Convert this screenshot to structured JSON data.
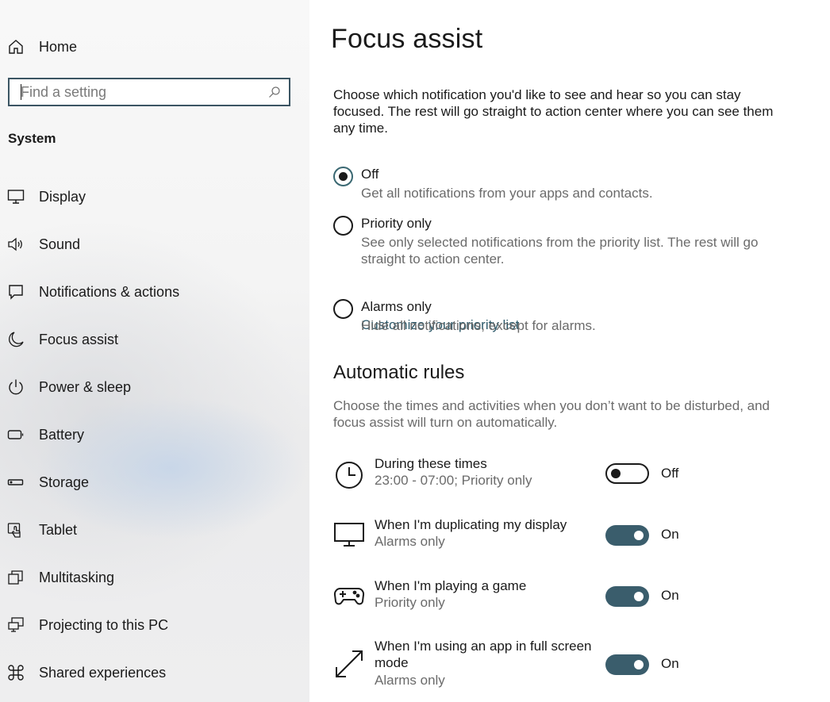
{
  "sidebar": {
    "home_label": "Home",
    "search": {
      "placeholder": "Find a setting",
      "value": ""
    },
    "section_title": "System",
    "items": [
      {
        "label": "Display",
        "icon": "display-icon"
      },
      {
        "label": "Sound",
        "icon": "speaker-icon"
      },
      {
        "label": "Notifications & actions",
        "icon": "notification-icon"
      },
      {
        "label": "Focus assist",
        "icon": "moon-icon"
      },
      {
        "label": "Power & sleep",
        "icon": "power-icon"
      },
      {
        "label": "Battery",
        "icon": "battery-icon"
      },
      {
        "label": "Storage",
        "icon": "storage-icon"
      },
      {
        "label": "Tablet",
        "icon": "tablet-icon"
      },
      {
        "label": "Multitasking",
        "icon": "multitasking-icon"
      },
      {
        "label": "Projecting to this PC",
        "icon": "projecting-icon"
      },
      {
        "label": "Shared experiences",
        "icon": "shared-experiences-icon"
      }
    ]
  },
  "main": {
    "title": "Focus assist",
    "intro": "Choose which notification you'd like to see and hear so you can stay focused. The rest will go straight to action center where you can see them any time.",
    "options": [
      {
        "label": "Off",
        "description": "Get all notifications from your apps and contacts.",
        "checked": true
      },
      {
        "label": "Priority only",
        "description": "See only selected notifications from the priority list. The rest will go straight to action center.",
        "link": "Customize your priority list",
        "checked": false
      },
      {
        "label": "Alarms only",
        "description": "Hide all notifications, except for alarms.",
        "checked": false
      }
    ],
    "rules_heading": "Automatic rules",
    "rules_description": "Choose the times and activities when you don’t want to be disturbed, and focus assist will turn on automatically.",
    "rules": [
      {
        "title": "During these times",
        "subtitle": "23:00 - 07:00; Priority only",
        "icon": "clock-icon",
        "state": "Off"
      },
      {
        "title": "When I'm duplicating my display",
        "subtitle": "Alarms only",
        "icon": "monitor-icon",
        "state": "On"
      },
      {
        "title": "When I'm playing a game",
        "subtitle": "Priority only",
        "icon": "gamepad-icon",
        "state": "On"
      },
      {
        "title": "When I'm using an app in full screen mode",
        "subtitle": "Alarms only",
        "icon": "fullscreen-icon",
        "state": "On"
      }
    ]
  },
  "colors": {
    "accent": "#3a5d6c",
    "link": "#2d5a6b",
    "secondary_text": "#6b6b6b",
    "search_border": "#3b5563"
  }
}
